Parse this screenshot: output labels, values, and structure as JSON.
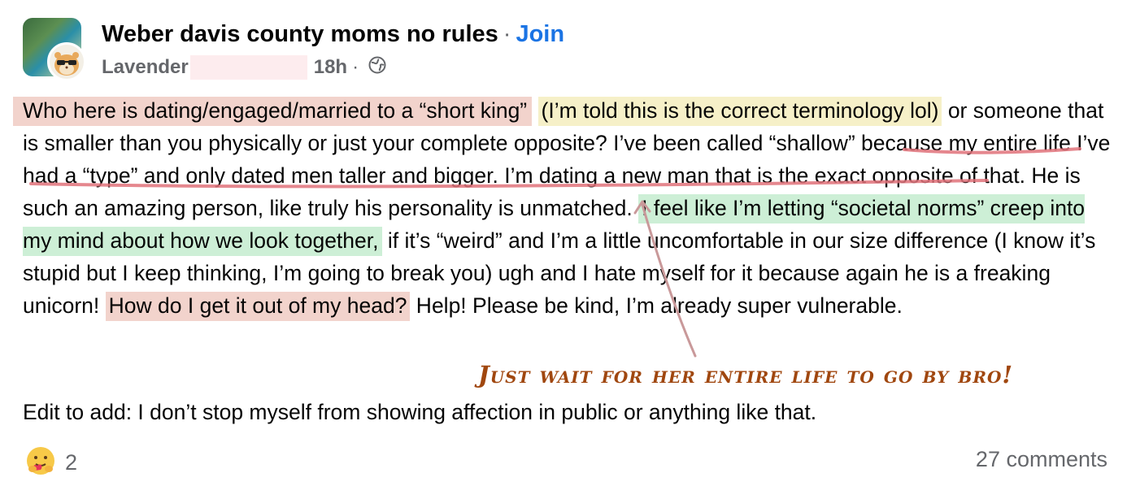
{
  "post": {
    "group_name": "Weber davis county moms no rules",
    "separator": "·",
    "join_label": "Join",
    "author": "Lavender",
    "time": "18h",
    "time_separator": "·",
    "privacy_icon": "globe-icon"
  },
  "body": {
    "seg1": "Who here is dating/engaged/married to a “short king”",
    "seg2": "(I’m told this is the correct terminology lol)",
    "seg3": " or someone that is smaller than you physically or just your complete opposite? I’ve been called “shallow” because my entire life I’ve had a “type” and only dated men taller and bigger. I’m dating a new man that is the exact opposite of that. He is such an amazing person, like truly his personality is unmatched. ",
    "seg4": "I feel like I’m letting “societal norms” creep into my mind about how we look together,",
    "seg5": " if it’s “weird” and I’m a little uncomfortable in our size difference (I know it’s stupid but I keep thinking, I’m going to break you) ugh and I hate myself for it because again he is a freaking unicorn! ",
    "seg6": "How do I get it out of my head?",
    "seg7": " Help! Please be kind, I’m already super vulnerable.",
    "edit": "Edit to add: I don’t stop myself from showing affection in public or anything like that."
  },
  "annotation": {
    "text": "Just wait for her entire life to go by bro!",
    "color": "#a0470f"
  },
  "highlight_colors": {
    "red": "#f2d3cc",
    "yellow": "#f6f0c8",
    "green": "#cdefd6",
    "underline": "#e0727a",
    "arrow": "#c9999a"
  },
  "footer": {
    "reaction_icon": "care-emoji-icon",
    "reaction_count": "2",
    "comments": "27 comments"
  }
}
